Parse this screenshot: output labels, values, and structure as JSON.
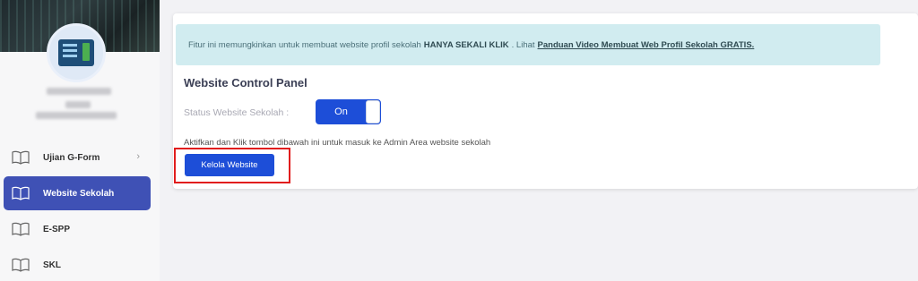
{
  "sidebar": {
    "items": [
      {
        "label": "Ujian G-Form",
        "icon": "book-icon",
        "has_chevron": true,
        "active": false
      },
      {
        "label": "Website Sekolah",
        "icon": "book-icon",
        "active": true
      },
      {
        "label": "E-SPP",
        "icon": "book-icon",
        "active": false
      },
      {
        "label": "SKL",
        "icon": "book-icon",
        "active": false
      }
    ]
  },
  "alert": {
    "text_prefix": "Fitur ini memungkinkan untuk membuat website profil sekolah",
    "text_bold": "HANYA SEKALI KLIK",
    "text_mid": ". Lihat",
    "link_text": "Panduan Video Membuat Web Profil Sekolah GRATIS."
  },
  "panel": {
    "title": "Website Control Panel",
    "status_label": "Status Website Sekolah :",
    "toggle_label": "On",
    "instruction": "Aktifkan dan Klik tombol dibawah ini untuk masuk ke Admin Area website sekolah",
    "button_label": "Kelola Website"
  },
  "colors": {
    "primary": "#1d4ed8",
    "sidebar_active": "#3f51b5",
    "alert_bg": "#d1ecf0",
    "highlight": "#e11d1d"
  }
}
